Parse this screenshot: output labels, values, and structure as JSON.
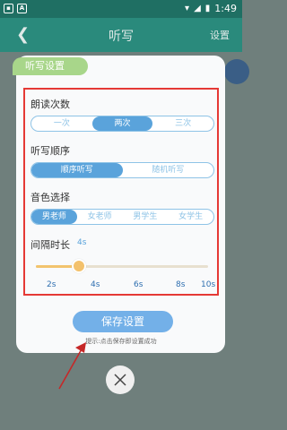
{
  "status_bar": {
    "time": "1:49",
    "left_icons": [
      "a-icon",
      "A"
    ]
  },
  "app_bar": {
    "back_icon": "back-icon",
    "title": "听写",
    "settings_label": "设置"
  },
  "panel": {
    "tag_label": "听写设置",
    "reading_count": {
      "label": "朗读次数",
      "options": [
        "一次",
        "两次",
        "三次"
      ],
      "selected": "两次"
    },
    "dictation_order": {
      "label": "听写顺序",
      "options": [
        "顺序听写",
        "随机听写"
      ],
      "selected": "顺序听写"
    },
    "voice": {
      "label": "音色选择",
      "options": [
        "男老师",
        "女老师",
        "男学生",
        "女学生"
      ],
      "selected": "男老师"
    },
    "interval": {
      "label": "间隔时长",
      "value_label": "4s",
      "value": 4,
      "ticks": [
        "2s",
        "4s",
        "6s",
        "8s",
        "10s"
      ]
    },
    "save_button": "保存设置",
    "hint": "提示:点击保存即设置成功"
  },
  "close_icon": "close-icon",
  "colors": {
    "status_bar": "#1f6f63",
    "app_bar": "#2a8a7c",
    "accent_blue": "#5aa3db",
    "tag_green": "#a8d68a",
    "slider_thumb": "#f3c16c",
    "red_box": "#e53935"
  }
}
